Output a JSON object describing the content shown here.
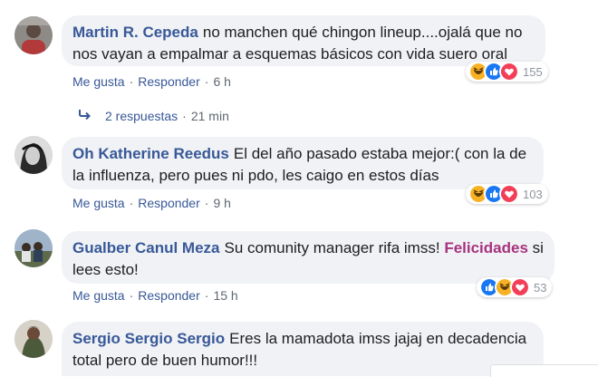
{
  "comments": [
    {
      "author": "Martin R. Cepeda",
      "text": "no manchen qué chingon lineup....ojalá que no nos vayan a empalmar a esquemas básicos con vida suero oral",
      "like_label": "Me gusta",
      "reply_label": "Responder",
      "time": "6 h",
      "reaction_count": "155",
      "reactions": [
        "haha-icon",
        "like-icon",
        "love-icon"
      ]
    },
    {
      "author": "Oh Katherine Reedus",
      "text": "El del año pasado estaba mejor:( con la de la influenza, pero pues ni pdo, les caigo en estos días",
      "like_label": "Me gusta",
      "reply_label": "Responder",
      "time": "9 h",
      "reaction_count": "103",
      "reactions": [
        "haha-icon",
        "like-icon",
        "love-icon"
      ]
    },
    {
      "author": "Gualber Canul Meza",
      "text": "Su comunity manager rifa imss!",
      "mention": "Felicidades",
      "text_after": "si lees esto!",
      "like_label": "Me gusta",
      "reply_label": "Responder",
      "time": "15 h",
      "reaction_count": "53",
      "reactions": [
        "like-icon",
        "haha-icon",
        "love-icon"
      ]
    },
    {
      "author": "Sergio Sergio Sergio",
      "text": "Eres la mamadota imss jajaj en decadencia total pero de buen humor!!!"
    }
  ],
  "replies": {
    "label": "2 respuestas",
    "time": "21 min"
  },
  "separator": "·",
  "colors": {
    "author": "#385898",
    "mention": "#a7337f",
    "bubble": "#f0f2f5",
    "like": "#1877f2",
    "love": "#f33e58",
    "haha": "#f7b125"
  }
}
